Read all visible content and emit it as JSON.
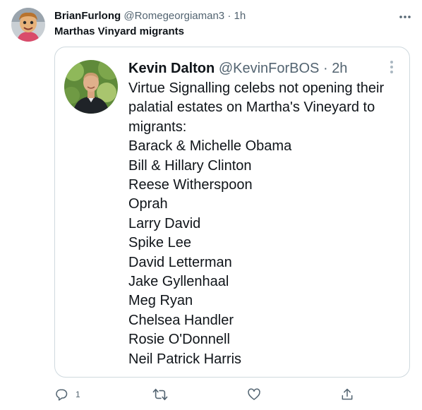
{
  "tweet": {
    "author_name": "BrianFurlong",
    "author_handle": "@Romegeorgiaman3",
    "separator": "·",
    "time": "1h",
    "text": "Marthas Vinyard migrants"
  },
  "quoted": {
    "author_name": "Kevin Dalton",
    "author_handle": "@KevinForBOS",
    "separator": "·",
    "time": "2h",
    "lines": [
      "Virtue Signalling celebs not opening their",
      "palatial estates on Martha's Vineyard to",
      "migrants:",
      "Barack & Michelle Obama",
      "Bill & Hillary Clinton",
      "Reese Witherspoon",
      "Oprah",
      "Larry David",
      "Spike Lee",
      "David Letterman",
      "Jake Gyllenhaal",
      "Meg Ryan",
      "Chelsea Handler",
      "Rosie O'Donnell",
      "Neil Patrick Harris"
    ]
  },
  "actions": {
    "reply_count": "1"
  },
  "colors": {
    "text_primary": "#0f1419",
    "text_secondary": "#536471",
    "border": "#cfd9de"
  },
  "icons": {
    "more": "more-horizontal-icon",
    "quote_more": "more-vertical-icon",
    "reply": "reply-icon",
    "retweet": "retweet-icon",
    "like": "like-icon",
    "share": "share-icon"
  }
}
